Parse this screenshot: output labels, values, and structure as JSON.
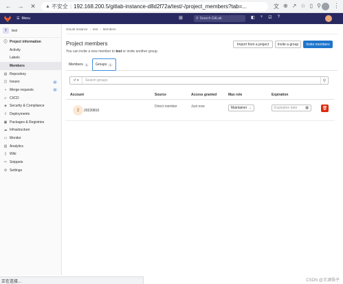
{
  "browser": {
    "insecure_label": "不安全",
    "url": "192.168.200.5/gitlab-instance-d8d2f72a/test/-/project_members?tab=..."
  },
  "gitlab_header": {
    "menu_label": "Menu",
    "search_placeholder": "Search GitLab"
  },
  "sidebar": {
    "project_initial": "T",
    "project_name": "test",
    "items": [
      {
        "label": "Project information",
        "icon": "info-icon"
      },
      {
        "label": "Activity"
      },
      {
        "label": "Labels"
      },
      {
        "label": "Members"
      },
      {
        "label": "Repository",
        "icon": "repository-icon"
      },
      {
        "label": "Issues",
        "icon": "issues-icon",
        "badge": "0"
      },
      {
        "label": "Merge requests",
        "icon": "merge-request-icon",
        "badge": "0"
      },
      {
        "label": "CI/CD",
        "icon": "rocket-icon"
      },
      {
        "label": "Security & Compliance",
        "icon": "shield-icon"
      },
      {
        "label": "Deployments",
        "icon": "deployments-icon"
      },
      {
        "label": "Packages & Registries",
        "icon": "package-icon"
      },
      {
        "label": "Infrastructure",
        "icon": "cloud-icon"
      },
      {
        "label": "Monitor",
        "icon": "monitor-icon"
      },
      {
        "label": "Analytics",
        "icon": "chart-icon"
      },
      {
        "label": "Wiki",
        "icon": "book-icon"
      },
      {
        "label": "Snippets",
        "icon": "snippet-icon"
      },
      {
        "label": "Settings",
        "icon": "gear-icon"
      }
    ]
  },
  "breadcrumb": [
    "GitLab Instance",
    "test",
    "Members"
  ],
  "page": {
    "title": "Project members",
    "subtitle_pre": "You can invite a new member to ",
    "subtitle_project": "test",
    "subtitle_post": " or invite another group.",
    "import_button": "Import from a project",
    "invite_group_button": "Invite a group",
    "invite_members_button": "Invite members"
  },
  "tabs": [
    {
      "label": "Members",
      "count": "1"
    },
    {
      "label": "Groups",
      "count": "1"
    }
  ],
  "filter": {
    "placeholder": "Search groups"
  },
  "table": {
    "headers": [
      "Account",
      "Source",
      "Access granted",
      "Max role",
      "Expiration"
    ],
    "rows": [
      {
        "avatar": "2",
        "account": "20220810",
        "source": "Direct member",
        "access": "Just now",
        "role": "Maintainer",
        "expiration_placeholder": "Expiration date"
      }
    ]
  },
  "status_bar": "正在连接...",
  "watermark": "CSDN @王酒悟子"
}
